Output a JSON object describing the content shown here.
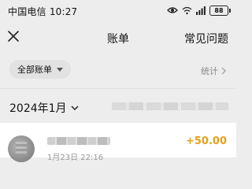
{
  "status_bar": {
    "carrier_time": "中国电信 10:27",
    "battery": "88"
  },
  "nav": {
    "title": "账单",
    "faq_label": "常见问题"
  },
  "filter": {
    "all_bills_label": "全部账单",
    "stats_label": "统计"
  },
  "month": {
    "label": "2024年1月"
  },
  "records": [
    {
      "time": "1月23日 22:16",
      "amount": "+50.00"
    }
  ],
  "colors": {
    "background": "#ededed",
    "amount_positive": "#e6a01b"
  }
}
